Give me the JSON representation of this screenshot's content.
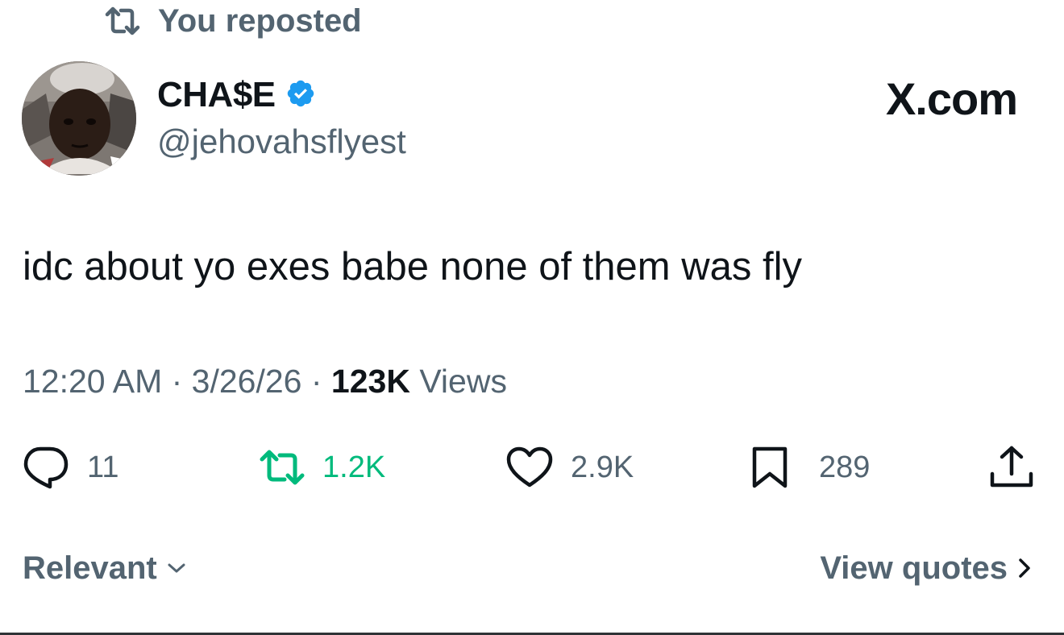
{
  "repost_banner": {
    "text": "You reposted",
    "icon": "repost-icon"
  },
  "author": {
    "display_name": "CHA$E",
    "handle": "@jehovahsflyest",
    "verified": true,
    "verified_color": "#1d9bf0",
    "avatar": "profile-photo"
  },
  "brand": "X.com",
  "tweet": {
    "text": "idc about yo exes babe none of them was fly"
  },
  "meta": {
    "time": "12:20 AM",
    "sep1": " · ",
    "date": "3/26/26",
    "sep2": " · ",
    "views_count": "123K",
    "views_label": " Views"
  },
  "actions": {
    "replies": {
      "count": "11",
      "icon": "reply-icon"
    },
    "reposts": {
      "count": "1.2K",
      "icon": "repost-icon",
      "active": true,
      "color": "#00ba7c"
    },
    "likes": {
      "count": "2.9K",
      "icon": "heart-icon"
    },
    "bookmarks": {
      "count": "289",
      "icon": "bookmark-icon"
    },
    "share": {
      "icon": "share-icon"
    }
  },
  "footer": {
    "sort_label": "Relevant",
    "sort_icon": "chevron-down-icon",
    "quotes_label": "View quotes",
    "quotes_icon": "chevron-right-icon"
  }
}
